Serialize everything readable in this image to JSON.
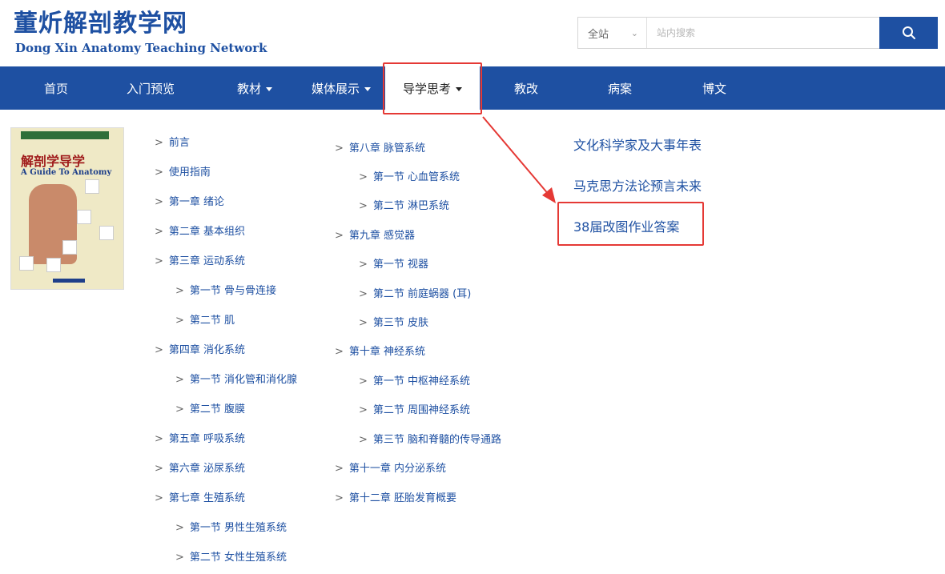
{
  "header": {
    "site_title": "董炘解剖教学网",
    "site_subtitle": "Dong Xin Anatomy Teaching Network"
  },
  "search": {
    "scope_label": "全站",
    "placeholder": "站内搜索"
  },
  "nav": {
    "items": [
      {
        "label": "首页"
      },
      {
        "label": "入门预览"
      },
      {
        "label": "教材"
      },
      {
        "label": "媒体展示"
      },
      {
        "label": "导学思考"
      },
      {
        "label": "教改"
      },
      {
        "label": "病案"
      },
      {
        "label": "博文"
      }
    ]
  },
  "book": {
    "title": "解剖学导学",
    "subtitle": "A Guide To Anatomy"
  },
  "toc_left": [
    "前言",
    "使用指南",
    "第一章 绪论",
    "第二章 基本组织",
    "第三章 运动系统",
    "第一节 骨与骨连接",
    "第二节 肌",
    "第四章 消化系统",
    "第一节 消化管和消化腺",
    "第二节 腹膜",
    "第五章 呼吸系统",
    "第六章 泌尿系统",
    "第七章 生殖系统",
    "第一节 男性生殖系统",
    "第二节 女性生殖系统"
  ],
  "toc_middle": [
    "第八章 脉管系统",
    "第一节 心血管系统",
    "第二节 淋巴系统",
    "第九章 感觉器",
    "第一节 视器",
    "第二节 前庭蜗器 (耳)",
    "第三节 皮肤",
    "第十章 神经系统",
    "第一节 中枢神经系统",
    "第二节 周围神经系统",
    "第三节 脑和脊髓的传导通路",
    "第十一章 内分泌系统",
    "第十二章 胚胎发育概要"
  ],
  "right_links": [
    "文化科学家及大事年表",
    "马克思方法论预言未来",
    "38届改图作业答案"
  ],
  "colors": {
    "brand_blue": "#1e50a2",
    "highlight_red": "#e53935"
  }
}
